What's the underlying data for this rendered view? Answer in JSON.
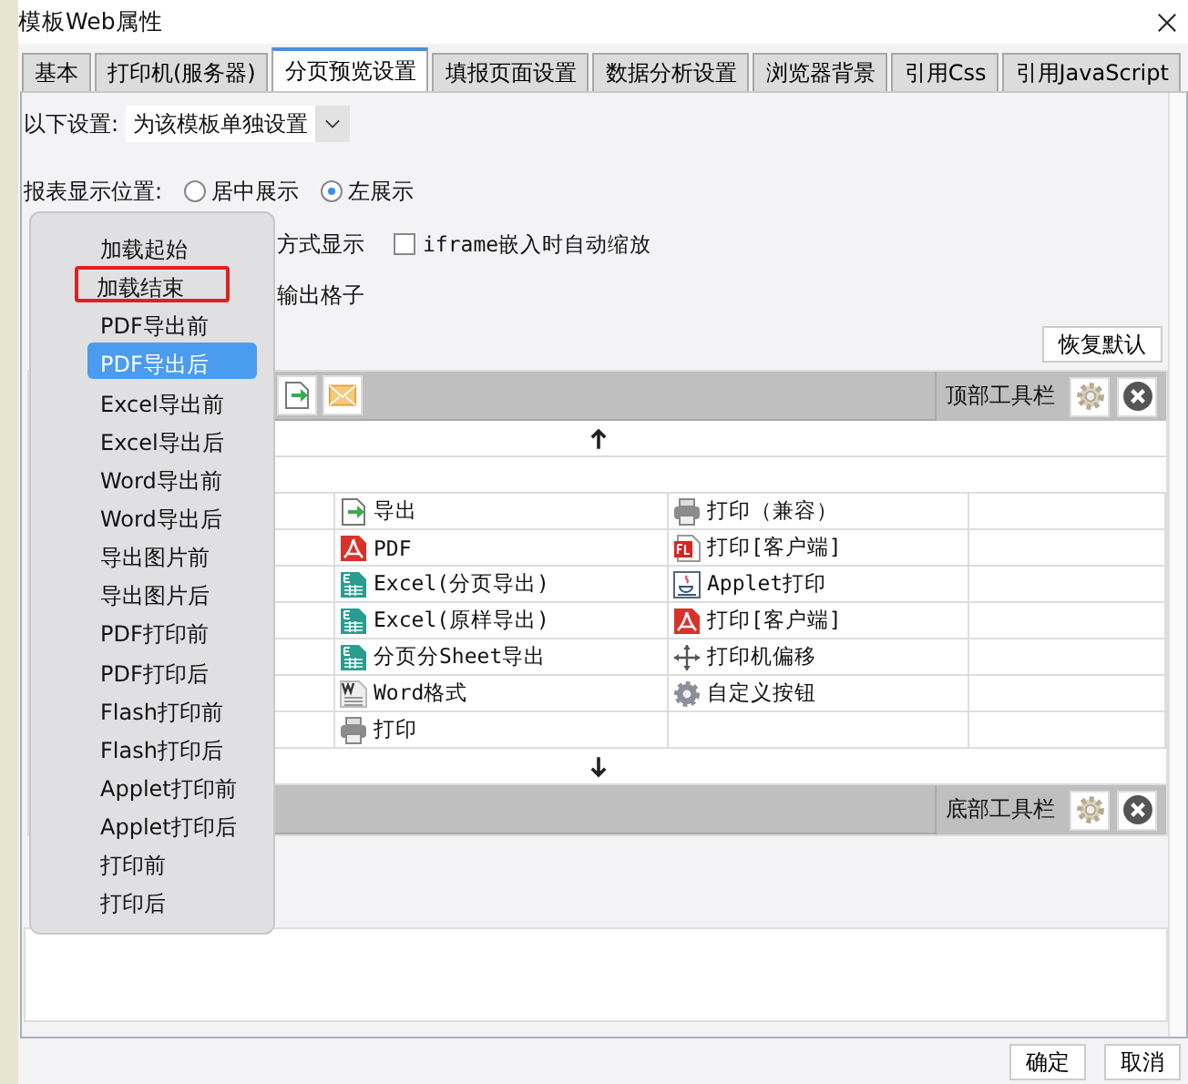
{
  "window": {
    "title": "模板Web属性"
  },
  "tabs": [
    {
      "label": "基本",
      "selected": false
    },
    {
      "label": "打印机(服务器)",
      "selected": false
    },
    {
      "label": "分页预览设置",
      "selected": true
    },
    {
      "label": "填报页面设置",
      "selected": false
    },
    {
      "label": "数据分析设置",
      "selected": false
    },
    {
      "label": "浏览器背景",
      "selected": false
    },
    {
      "label": "引用Css",
      "selected": false
    },
    {
      "label": "引用JavaScript",
      "selected": false
    }
  ],
  "settings_scope": {
    "label": "以下设置:",
    "value": "为该模板单独设置"
  },
  "display_position": {
    "label": "报表显示位置:",
    "options": [
      {
        "label": "居中展示",
        "selected": false
      },
      {
        "label": "左展示",
        "selected": true
      }
    ]
  },
  "display_mode_tail": "方式显示",
  "iframe_autoscale": {
    "label": "iframe嵌入时自动缩放",
    "checked": false
  },
  "output_cells_tail": "输出格子",
  "restore_default_button": "恢复默认",
  "top_toolbar": {
    "label": "顶部工具栏"
  },
  "toolbar_rows": [
    [
      {
        "kind": "export",
        "label": "导出"
      },
      {
        "kind": "print",
        "label": "打印（兼容）"
      }
    ],
    [
      {
        "kind": "pdf",
        "label": "PDF"
      },
      {
        "kind": "flash",
        "label": "打印[客户端]"
      }
    ],
    [
      {
        "kind": "excel",
        "label": "Excel(分页导出)"
      },
      {
        "kind": "applet",
        "label": "Applet打印"
      }
    ],
    [
      {
        "kind": "excel",
        "label": "Excel(原样导出)"
      },
      {
        "kind": "pdf",
        "label": "打印[客户端]"
      }
    ],
    [
      {
        "kind": "excel",
        "label": "分页分Sheet导出"
      },
      {
        "kind": "move",
        "label": "打印机偏移"
      }
    ],
    [
      {
        "kind": "word",
        "label": "Word格式"
      },
      {
        "kind": "gear",
        "label": "自定义按钮"
      }
    ],
    [
      {
        "kind": "print",
        "label": "打印"
      }
    ]
  ],
  "bottom_toolbar": {
    "label": "底部工具栏"
  },
  "event_menu": [
    {
      "label": "加载起始",
      "selected": false,
      "outlined": false
    },
    {
      "label": "加载结束",
      "selected": false,
      "outlined": true
    },
    {
      "label": "PDF导出前",
      "selected": false,
      "outlined": false
    },
    {
      "label": "PDF导出后",
      "selected": true,
      "outlined": false
    },
    {
      "label": "Excel导出前",
      "selected": false,
      "outlined": false
    },
    {
      "label": "Excel导出后",
      "selected": false,
      "outlined": false
    },
    {
      "label": "Word导出前",
      "selected": false,
      "outlined": false
    },
    {
      "label": "Word导出后",
      "selected": false,
      "outlined": false
    },
    {
      "label": "导出图片前",
      "selected": false,
      "outlined": false
    },
    {
      "label": "导出图片后",
      "selected": false,
      "outlined": false
    },
    {
      "label": "PDF打印前",
      "selected": false,
      "outlined": false
    },
    {
      "label": "PDF打印后",
      "selected": false,
      "outlined": false
    },
    {
      "label": "Flash打印前",
      "selected": false,
      "outlined": false
    },
    {
      "label": "Flash打印后",
      "selected": false,
      "outlined": false
    },
    {
      "label": "Applet打印前",
      "selected": false,
      "outlined": false
    },
    {
      "label": "Applet打印后",
      "selected": false,
      "outlined": false
    },
    {
      "label": "打印前",
      "selected": false,
      "outlined": false
    },
    {
      "label": "打印后",
      "selected": false,
      "outlined": false
    }
  ],
  "footer_buttons": [
    "确定",
    "取消"
  ]
}
